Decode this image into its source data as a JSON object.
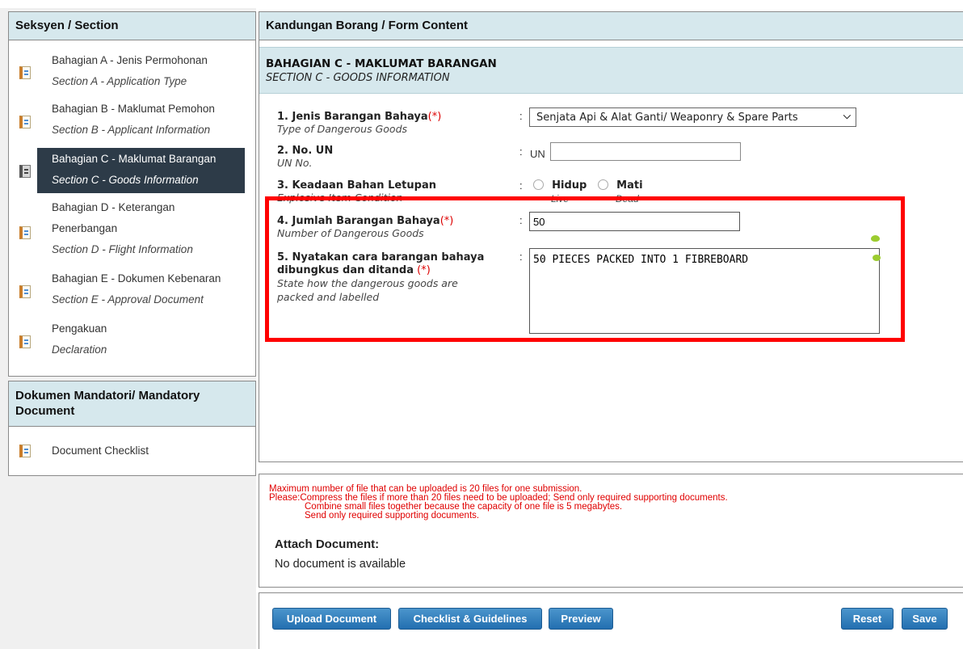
{
  "sidebar": {
    "title": "Seksyen / Section",
    "items": [
      {
        "label": "Bahagian A - Jenis Permohonan",
        "sublabel": "Section A - Application Type"
      },
      {
        "label": "Bahagian B - Maklumat Pemohon",
        "sublabel": "Section B - Applicant Information"
      },
      {
        "label": "Bahagian C - Maklumat Barangan",
        "sublabel": "Section C - Goods Information"
      },
      {
        "label": "Bahagian D - Keterangan",
        "label2": "Penerbangan",
        "sublabel": "Section D - Flight Information"
      },
      {
        "label": "Bahagian E - Dokumen Kebenaran",
        "sublabel": "Section E - Approval Document"
      },
      {
        "label": "Pengakuan",
        "sublabel": "Declaration"
      }
    ]
  },
  "mandatory": {
    "title": "Dokumen Mandatori/ Mandatory Document",
    "item": "Document Checklist"
  },
  "form": {
    "title": "Kandungan Borang / Form Content",
    "section_title": "BAHAGIAN C - MAKLUMAT BARANGAN",
    "section_subtitle": "SECTION C - GOODS INFORMATION",
    "fields": {
      "f1": {
        "label": "1. Jenis Barangan Bahaya",
        "req": "(*)",
        "sublabel": "Type of Dangerous Goods",
        "value": "Senjata Api & Alat Ganti/ Weaponry & Spare Parts"
      },
      "f2": {
        "label": "2. No. UN",
        "sublabel": "UN No.",
        "prefix": "UN",
        "value": ""
      },
      "f3": {
        "label": "3. Keadaan Bahan Letupan",
        "sublabel": "Explosive Item Condition",
        "opt1": "Hidup",
        "opt1_sub": "Live",
        "opt2": "Mati",
        "opt2_sub": "Dead"
      },
      "f4": {
        "label": "4. Jumlah Barangan Bahaya",
        "req": "(*)",
        "sublabel": "Number of Dangerous Goods",
        "value": "50"
      },
      "f5": {
        "label": "5. Nyatakan cara barangan bahaya",
        "label2": "dibungkus dan ditanda",
        "req": "(*)",
        "sublabel": "State how the dangerous goods are",
        "sublabel2": "packed and labelled",
        "value": "50 PIECES PACKED INTO 1 FIBREBOARD"
      }
    },
    "colon": ":"
  },
  "attachments": {
    "notes": [
      "Maximum number of file that can be uploaded is 20 files for one submission.",
      "Please:Compress the files if more than 20 files need to be uploaded; Send only required supporting documents.",
      "Combine small files together because the capacity of one file is 5 megabytes.",
      "Send only required supporting documents."
    ],
    "heading": "Attach Document:",
    "empty": "No document is available"
  },
  "buttons": {
    "upload": "Upload Document",
    "checklist": "Checklist & Guidelines",
    "preview": "Preview",
    "reset": "Reset",
    "save": "Save"
  },
  "colors": {
    "accent": "#2d3b48",
    "header_bg": "#d6e8ed",
    "highlight": "#ff0000",
    "button": "#236fb0"
  }
}
